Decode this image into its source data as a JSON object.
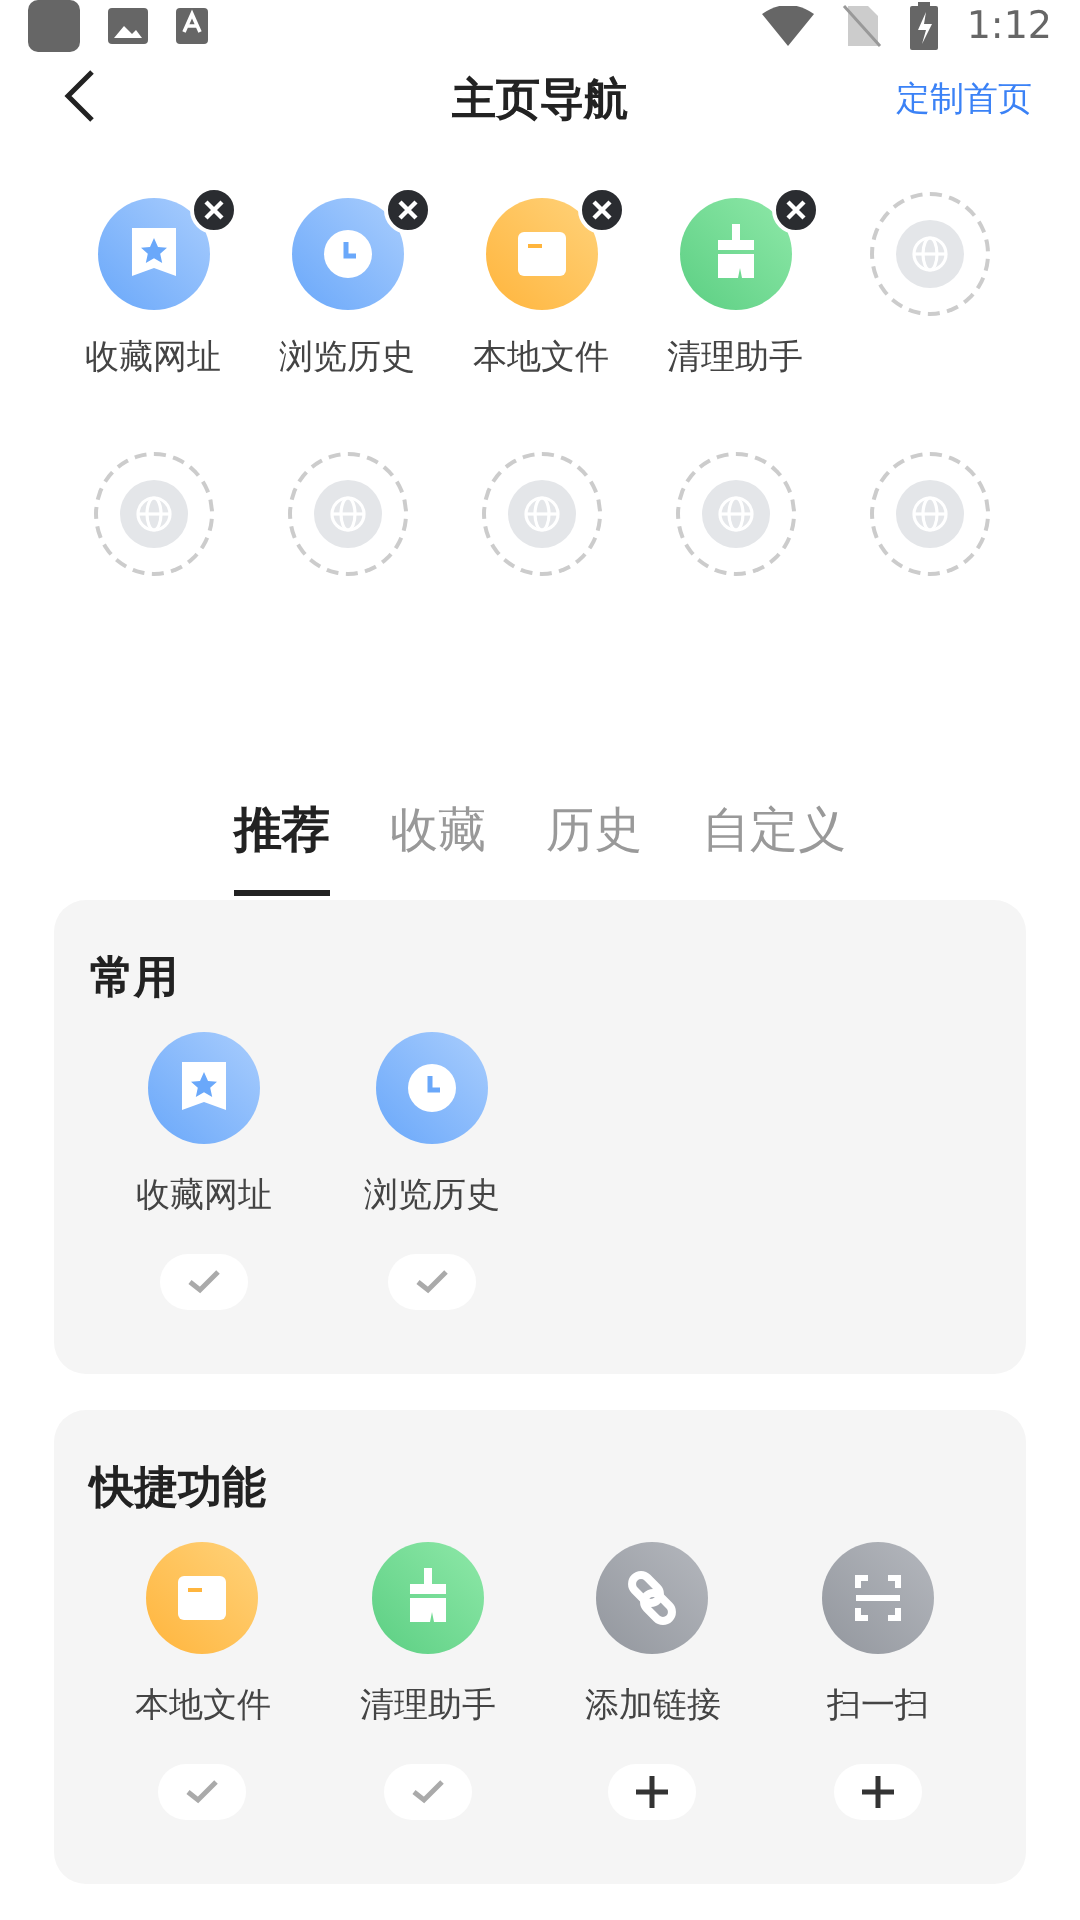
{
  "status_bar": {
    "time": "1:12"
  },
  "header": {
    "title": "主页导航",
    "action": "定制首页"
  },
  "slots": [
    {
      "kind": "bookmark",
      "label": "收藏网址",
      "removable": true
    },
    {
      "kind": "clock",
      "label": "浏览历史",
      "removable": true
    },
    {
      "kind": "folder",
      "label": "本地文件",
      "removable": true
    },
    {
      "kind": "broom",
      "label": "清理助手",
      "removable": true
    },
    {
      "kind": "empty"
    },
    {
      "kind": "empty"
    },
    {
      "kind": "empty"
    },
    {
      "kind": "empty"
    },
    {
      "kind": "empty"
    },
    {
      "kind": "empty"
    }
  ],
  "tabs": [
    {
      "label": "推荐",
      "selected": true
    },
    {
      "label": "收藏",
      "selected": false
    },
    {
      "label": "历史",
      "selected": false
    },
    {
      "label": "自定义",
      "selected": false
    }
  ],
  "sections": [
    {
      "title": "常用",
      "items": [
        {
          "kind": "bookmark",
          "label": "收藏网址",
          "added": true
        },
        {
          "kind": "clock",
          "label": "浏览历史",
          "added": true
        }
      ]
    },
    {
      "title": "快捷功能",
      "items": [
        {
          "kind": "folder",
          "label": "本地文件",
          "added": true
        },
        {
          "kind": "broom",
          "label": "清理助手",
          "added": true
        },
        {
          "kind": "link",
          "label": "添加链接",
          "added": false
        },
        {
          "kind": "scan",
          "label": "扫一扫",
          "added": false
        }
      ]
    }
  ]
}
